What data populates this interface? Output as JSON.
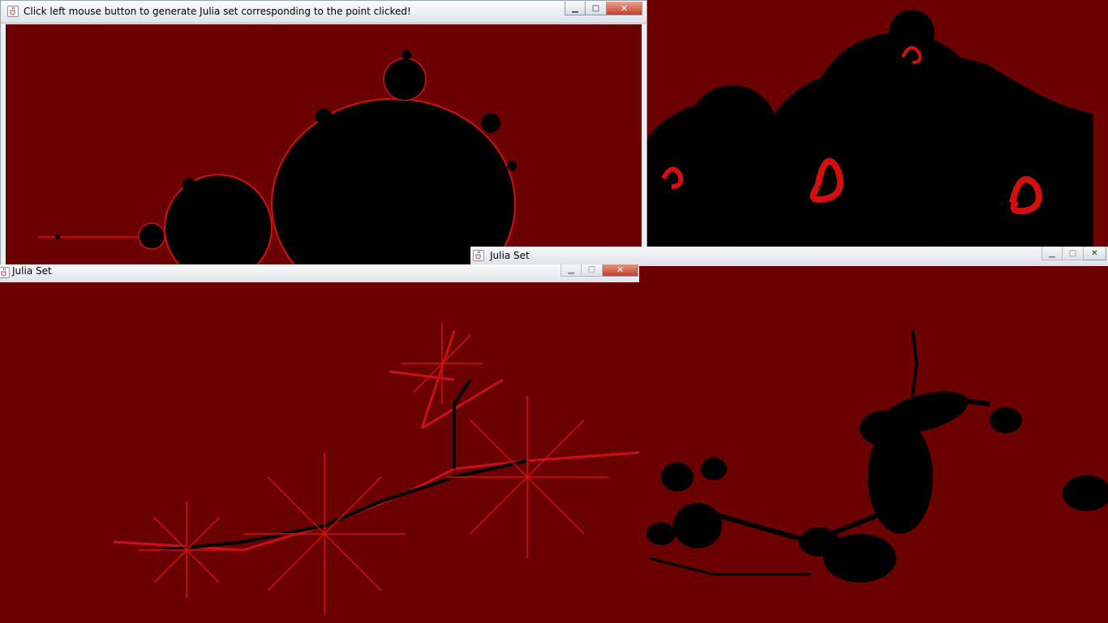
{
  "windows": {
    "mandelbrot": {
      "title": "Click left mouse button to generate Julia set corresponding to the point clicked!",
      "controls": [
        "minimize",
        "maximize",
        "close"
      ]
    },
    "julia_left": {
      "title": "Julia Set"
    },
    "julia_right": {
      "title": "Julia Set"
    }
  },
  "colors": {
    "background": "#6b0000",
    "set": "#000000",
    "edge": "#d40f0f",
    "titlebar": "#e6e9ed"
  },
  "icons": {
    "window": "java-cup-icon",
    "minimize": "minimize-icon",
    "maximize": "maximize-icon",
    "close": "close-icon"
  }
}
